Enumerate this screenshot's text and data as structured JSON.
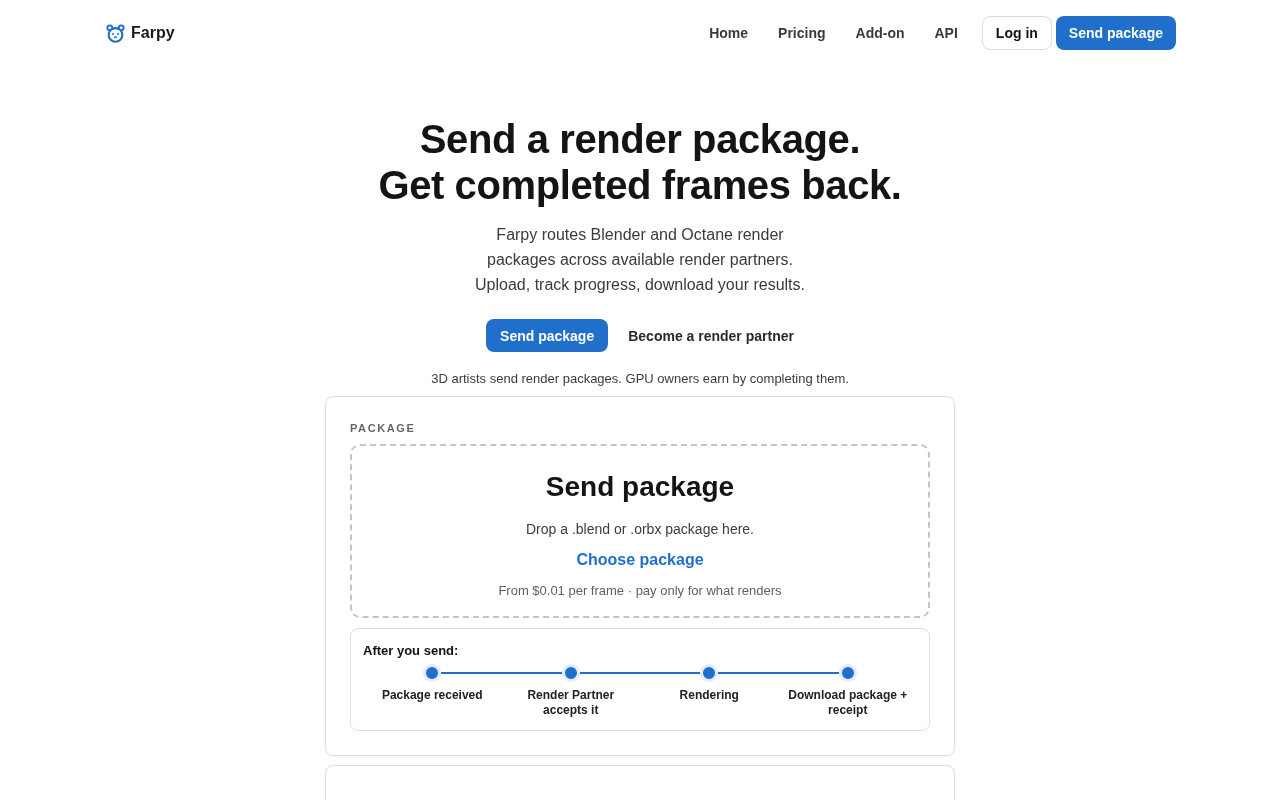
{
  "header": {
    "brand": "Farpy",
    "nav": [
      {
        "label": "Home"
      },
      {
        "label": "Pricing"
      },
      {
        "label": "Add-on"
      },
      {
        "label": "API"
      }
    ],
    "login": "Log in",
    "cta": "Send package"
  },
  "hero": {
    "title_lines": [
      "Send a render package.",
      "Get completed frames back."
    ],
    "subtitle_lines": [
      "Farpy routes Blender and Octane render",
      "packages across available render partners.",
      "Upload, track progress, download your results."
    ],
    "primary_button": "Send package",
    "secondary_link": "Become a render partner",
    "tagline": "3D artists send render packages. GPU owners earn by completing them."
  },
  "package_card": {
    "label": "PACKAGE",
    "dropzone": {
      "title": "Send package",
      "hint": "Drop a .blend or .orbx package here.",
      "link": "Choose package",
      "price_note": "From $0.01 per frame · pay only for what renders"
    },
    "steps": {
      "title": "After you send:",
      "items": [
        {
          "label": "Package received"
        },
        {
          "label": "Render Partner accepts it"
        },
        {
          "label": "Rendering"
        },
        {
          "label": "Download package + receipt"
        }
      ]
    }
  }
}
